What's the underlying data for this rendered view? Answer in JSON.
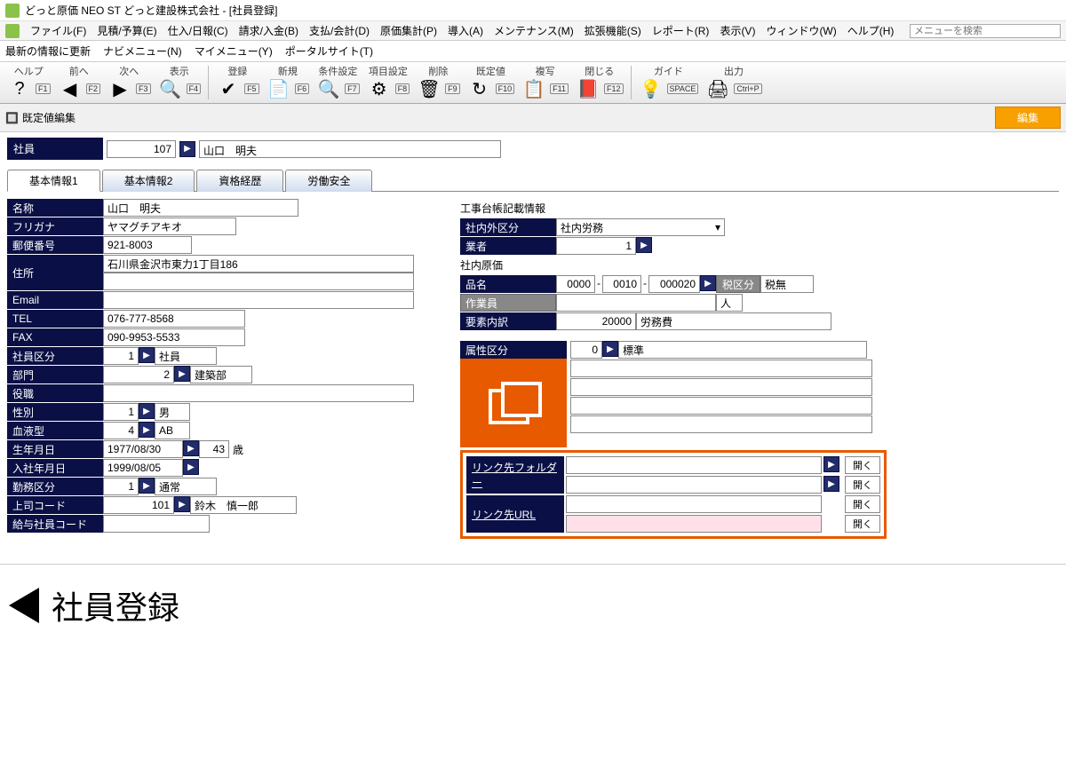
{
  "window": {
    "title": "どっと原価 NEO ST どっと建設株式会社 - [社員登録]"
  },
  "menubar": {
    "items": [
      "ファイル(F)",
      "見積/予算(E)",
      "仕入/日報(C)",
      "請求/入金(B)",
      "支払/会計(D)",
      "原価集計(P)",
      "導入(A)",
      "メンテナンス(M)",
      "拡張機能(S)",
      "レポート(R)",
      "表示(V)",
      "ウィンドウ(W)",
      "ヘルプ(H)"
    ],
    "search_placeholder": "メニューを検索"
  },
  "submenubar": {
    "items": [
      "最新の情報に更新",
      "ナビメニュー(N)",
      "マイメニュー(Y)",
      "ポータルサイト(T)"
    ]
  },
  "toolbar": {
    "groups": [
      {
        "label": "ヘルプ",
        "fkey": "F1",
        "icon": "?"
      },
      {
        "label": "前へ",
        "fkey": "F2",
        "icon": "◀"
      },
      {
        "label": "次へ",
        "fkey": "F3",
        "icon": "▶"
      },
      {
        "label": "表示",
        "fkey": "F4",
        "icon": "🔍"
      },
      {
        "label": "登録",
        "fkey": "F5",
        "icon": "✔"
      },
      {
        "label": "新規",
        "fkey": "F6",
        "icon": "📄"
      },
      {
        "label": "条件設定",
        "fkey": "F7",
        "icon": "🔍"
      },
      {
        "label": "項目設定",
        "fkey": "F8",
        "icon": "⚙"
      },
      {
        "label": "削除",
        "fkey": "F9",
        "icon": "🗑"
      },
      {
        "label": "既定値",
        "fkey": "F10",
        "icon": "↻"
      },
      {
        "label": "複写",
        "fkey": "F11",
        "icon": "📋"
      },
      {
        "label": "閉じる",
        "fkey": "F12",
        "icon": "📕"
      },
      {
        "label": "ガイド",
        "fkey": "SPACE",
        "icon": "💡"
      },
      {
        "label": "出力",
        "fkey": "Ctrl+P",
        "icon": "🖨"
      }
    ]
  },
  "section_header": {
    "title": "既定値編集",
    "edit_btn": "編集"
  },
  "employee": {
    "label": "社員",
    "id": "107",
    "name": "山口　明夫"
  },
  "tabs": [
    "基本情報1",
    "基本情報2",
    "資格経歴",
    "労働安全"
  ],
  "active_tab": 0,
  "basic": {
    "name_label": "名称",
    "name": "山口　明夫",
    "kana_label": "フリガナ",
    "kana": "ヤマグチアキオ",
    "zip_label": "郵便番号",
    "zip": "921-8003",
    "addr_label": "住所",
    "addr1": "石川県金沢市東力1丁目186",
    "addr2": "",
    "email_label": "Email",
    "email": "",
    "tel_label": "TEL",
    "tel": "076-777-8568",
    "fax_label": "FAX",
    "fax": "090-9953-5533",
    "emp_div_label": "社員区分",
    "emp_div_code": "1",
    "emp_div_name": "社員",
    "dept_label": "部門",
    "dept_code": "2",
    "dept_name": "建築部",
    "position_label": "役職",
    "position": "",
    "gender_label": "性別",
    "gender_code": "1",
    "gender_name": "男",
    "blood_label": "血液型",
    "blood_code": "4",
    "blood_name": "AB",
    "birth_label": "生年月日",
    "birth": "1977/08/30",
    "age": "43",
    "age_unit": "歳",
    "hire_label": "入社年月日",
    "hire": "1999/08/05",
    "work_div_label": "勤務区分",
    "work_div_code": "1",
    "work_div_name": "通常",
    "boss_label": "上司コード",
    "boss_code": "101",
    "boss_name": "鈴木　慎一郎",
    "payroll_label": "給与社員コード",
    "payroll": ""
  },
  "ledger": {
    "header": "工事台帳記載情報",
    "inout_label": "社内外区分",
    "inout_value": "社内労務",
    "vendor_label": "業者",
    "vendor_code": "1",
    "cost_header": "社内原価",
    "item_label": "品名",
    "item1": "0000",
    "item2": "0010",
    "item3": "000020",
    "tax_label": "税区分",
    "tax_value": "税無",
    "worker_label": "作業員",
    "worker_unit": "人",
    "element_label": "要素内訳",
    "element_value": "20000",
    "element_name": "労務費",
    "attr_label": "属性区分",
    "attr_code": "0",
    "attr_name": "標準"
  },
  "links": {
    "folder_label": "リンク先フォルダー",
    "url_label": "リンク先URL",
    "open_btn": "開く"
  },
  "footer": {
    "title": "社員登録"
  }
}
